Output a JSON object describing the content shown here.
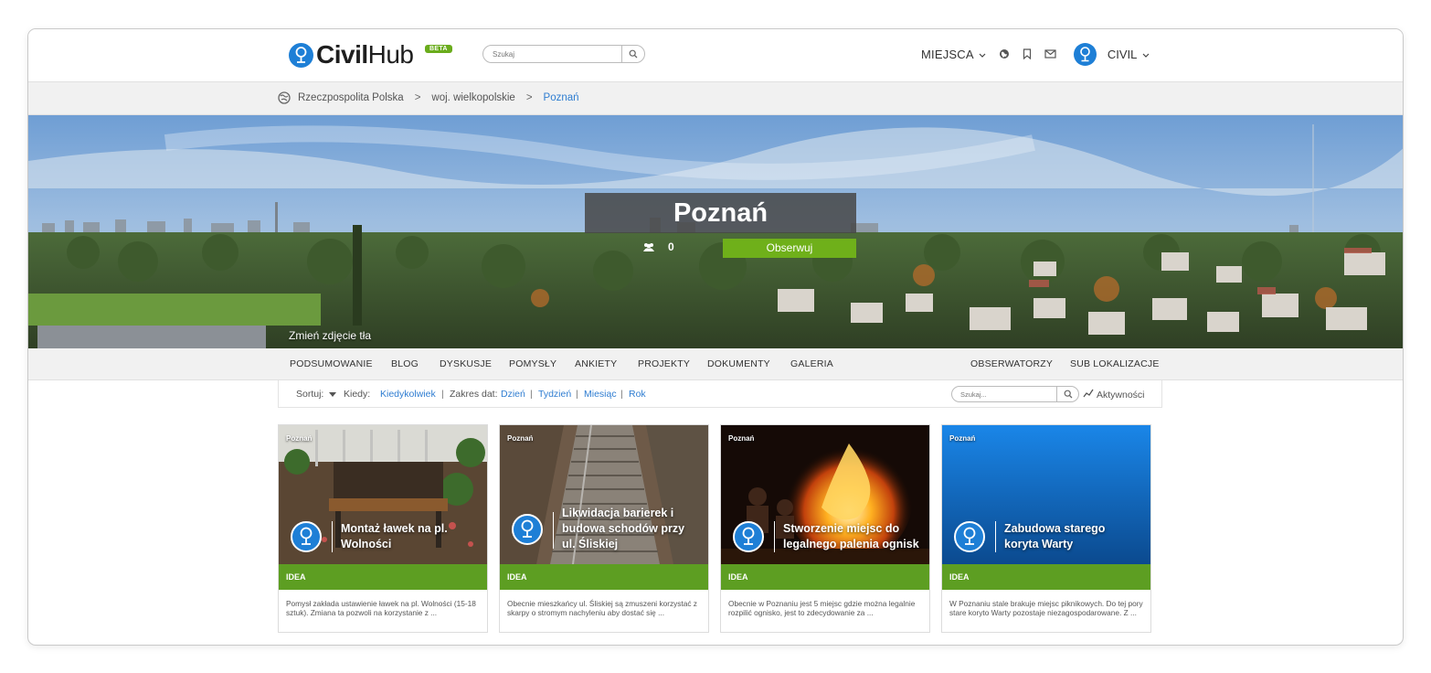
{
  "header": {
    "logo_main": "Civil",
    "logo_hub": "Hub",
    "beta_badge": "BETA",
    "search_placeholder": "Szukaj",
    "places_menu": "MIEJSCA",
    "user_name": "CIVIL",
    "icons": [
      "globe-icon",
      "bookmark-icon",
      "envelope-icon",
      "search-icon",
      "chevron-down-icon"
    ]
  },
  "breadcrumb": {
    "items": [
      "Rzeczpospolita Polska",
      "woj. wielkopolskie",
      "Poznań"
    ],
    "separator": ">"
  },
  "hero": {
    "title": "Poznań",
    "followers_count": "0",
    "follow_button": "Obserwuj",
    "change_background": "Zmień zdjęcie tła"
  },
  "tabs": {
    "left": [
      "PODSUMOWANIE",
      "BLOG",
      "DYSKUSJE",
      "POMYSŁY",
      "ANKIETY",
      "PROJEKTY",
      "DOKUMENTY",
      "GALERIA"
    ],
    "right": [
      "OBSERWATORZY",
      "SUB LOKALIZACJE"
    ]
  },
  "filter": {
    "sort_label": "Sortuj:",
    "when_label": "Kiedy:",
    "when_value": "Kiedykolwiek",
    "date_range_label": "Zakres dat:",
    "ranges": [
      "Dzień",
      "Tydzień",
      "Miesiąc",
      "Rok"
    ],
    "search_placeholder": "Szukaj...",
    "activity_label": "Aktywności"
  },
  "cards": [
    {
      "location": "Poznań",
      "title": "Montaż ławek na pl. Wolności",
      "type": "IDEA",
      "description": "Pomysł zakłada ustawienie ławek na pl. Wolności (15-18 sztuk). Zmiana ta pozwoli na korzystanie z ..."
    },
    {
      "location": "Poznań",
      "title": "Likwidacja barierek i budowa schodów przy ul. Śliskiej",
      "type": "IDEA",
      "description": "Obecnie mieszkańcy ul. Śliskiej są zmuszeni korzystać z skarpy o stromym nachyleniu aby dostać się ..."
    },
    {
      "location": "Poznań",
      "title": "Stworzenie miejsc do legalnego palenia ognisk",
      "type": "IDEA",
      "description": "Obecnie w Poznaniu jest 5 miejsc gdzie można legalnie rozpilić ognisko, jest to zdecydowanie za ..."
    },
    {
      "location": "Poznań",
      "title": "Zabudowa starego koryta Warty",
      "type": "IDEA",
      "description": "W Poznaniu stale brakuje miejsc piknikowych. Do tej pory stare koryto Warty pozostaje niezagospodarowane. Z ..."
    }
  ],
  "colors": {
    "brand_blue": "#1e7fd6",
    "link_blue": "#2f7dd1",
    "follow_green": "#6fb01a",
    "idea_green": "#5d9e22"
  }
}
